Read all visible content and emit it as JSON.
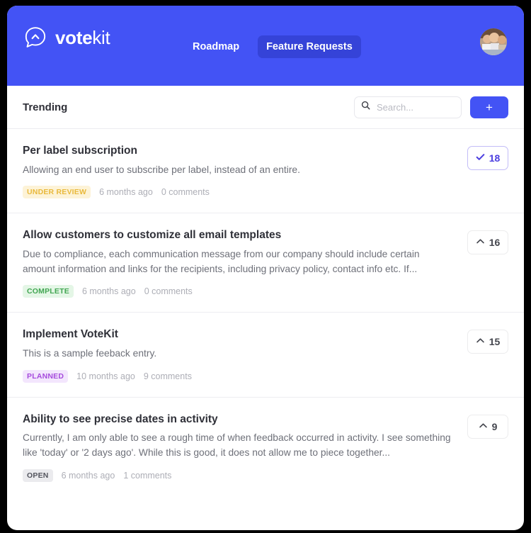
{
  "brand": {
    "name_bold": "vote",
    "name_light": "kit"
  },
  "nav": {
    "items": [
      {
        "label": "Roadmap",
        "active": false
      },
      {
        "label": "Feature Requests",
        "active": true
      }
    ]
  },
  "toolbar": {
    "section_label": "Trending",
    "search_placeholder": "Search...",
    "search_value": "",
    "add_label": "+"
  },
  "colors": {
    "header_blue": "#4353f5",
    "active_tab_blue": "#3543d8",
    "voted_purple": "#4c3fe0",
    "badge_under_review_text": "#e9b93c",
    "badge_complete_text": "#42a652",
    "badge_planned_text": "#a64bdd",
    "badge_open_text": "#53555e"
  },
  "items": [
    {
      "title": "Per label subscription",
      "description": "Allowing an end user to subscribe per label, instead of an entire.",
      "status": "UNDER REVIEW",
      "status_key": "under_review",
      "age": "6 months ago",
      "comments": "0 comments",
      "votes": "18",
      "voted": true
    },
    {
      "title": "Allow customers to customize all email templates",
      "description": "Due to compliance, each communication message from our company should include certain amount information and links for the recipients, including privacy policy, contact info etc. If...",
      "status": "COMPLETE",
      "status_key": "complete",
      "age": "6 months ago",
      "comments": "0 comments",
      "votes": "16",
      "voted": false
    },
    {
      "title": "Implement VoteKit",
      "description": "This is a sample feeback entry.",
      "status": "PLANNED",
      "status_key": "planned",
      "age": "10 months ago",
      "comments": "9 comments",
      "votes": "15",
      "voted": false
    },
    {
      "title": "Ability to see precise dates in activity",
      "description": "Currently, I am only able to see a rough time of when feedback occurred in activity. I see something like 'today' or '2 days ago'. While this is good, it does not allow me to piece together...",
      "status": "OPEN",
      "status_key": "open",
      "age": "6 months ago",
      "comments": "1 comments",
      "votes": "9",
      "voted": false
    }
  ]
}
